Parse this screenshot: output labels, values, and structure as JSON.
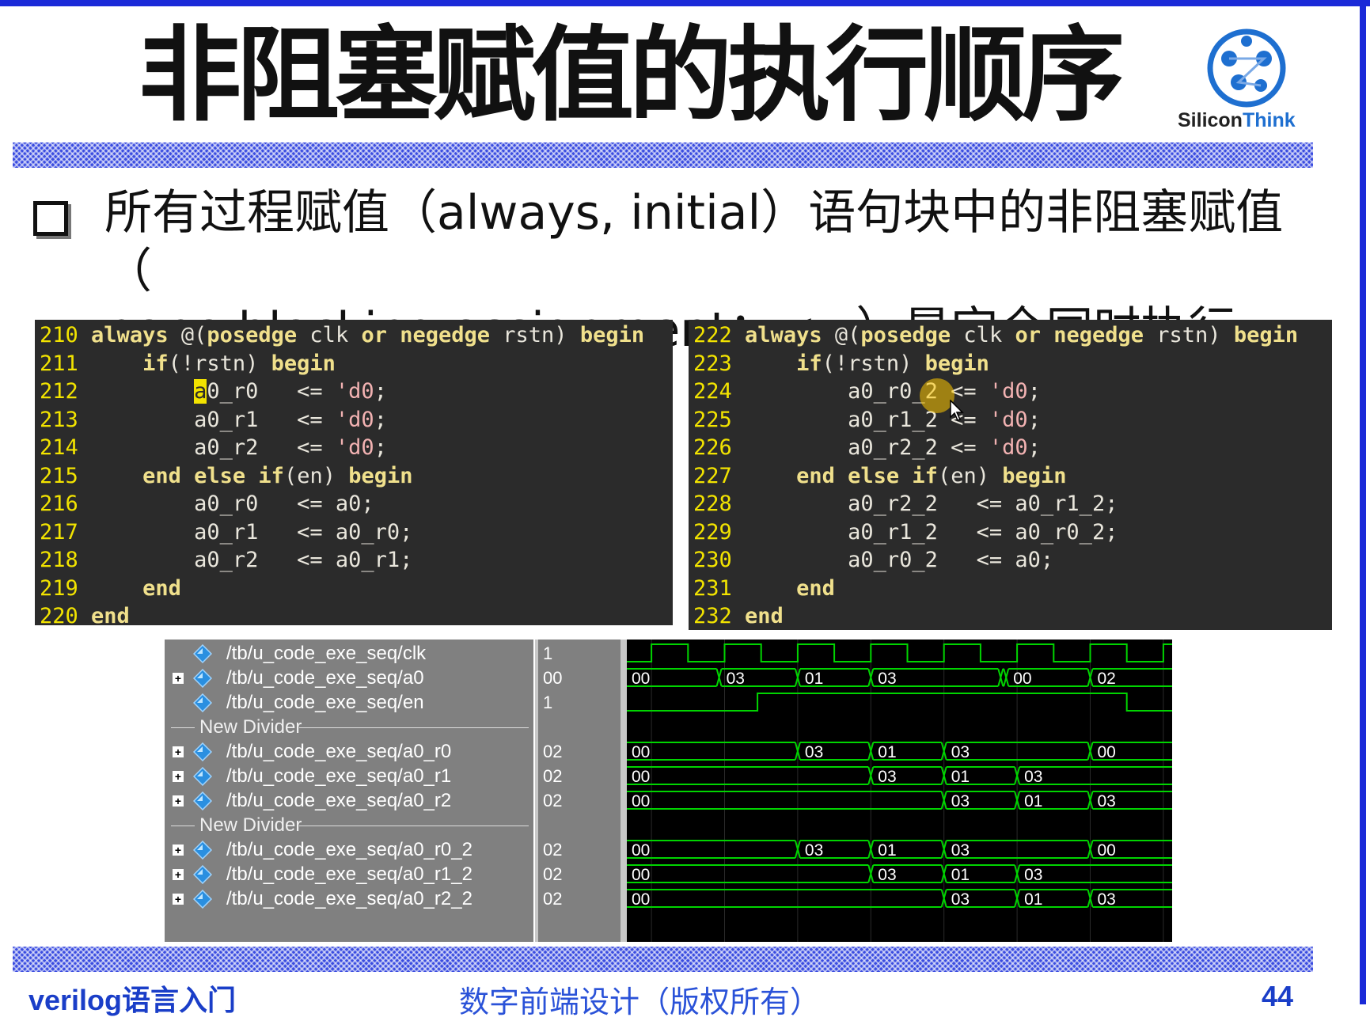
{
  "slide": {
    "title": "非阻塞赋值的执行顺序",
    "logo_text_a": "Silicon",
    "logo_text_b": "Think",
    "bullet_line1": "所有过程赋值（always, initial）语句块中的非阻塞赋值（",
    "bullet_line2": "none blocking assignment：<=）是完全同时执行的；"
  },
  "code_left": {
    "lines": [
      {
        "n": "210",
        "text": "always @(posedge clk or negedge rstn) begin"
      },
      {
        "n": "211",
        "text": "    if(!rstn) begin"
      },
      {
        "n": "212",
        "text": "        a0_r0   <= 'd0;"
      },
      {
        "n": "213",
        "text": "        a0_r1   <= 'd0;"
      },
      {
        "n": "214",
        "text": "        a0_r2   <= 'd0;"
      },
      {
        "n": "215",
        "text": "    end else if(en) begin"
      },
      {
        "n": "216",
        "text": "        a0_r0   <= a0;"
      },
      {
        "n": "217",
        "text": "        a0_r1   <= a0_r0;"
      },
      {
        "n": "218",
        "text": "        a0_r2   <= a0_r1;"
      },
      {
        "n": "219",
        "text": "    end"
      },
      {
        "n": "220",
        "text": "end"
      }
    ]
  },
  "code_right": {
    "lines": [
      {
        "n": "222",
        "text": "always @(posedge clk or negedge rstn) begin"
      },
      {
        "n": "223",
        "text": "    if(!rstn) begin"
      },
      {
        "n": "224",
        "text": "        a0_r0_2 <= 'd0;"
      },
      {
        "n": "225",
        "text": "        a0_r1_2 <= 'd0;"
      },
      {
        "n": "226",
        "text": "        a0_r2_2 <= 'd0;"
      },
      {
        "n": "227",
        "text": "    end else if(en) begin"
      },
      {
        "n": "228",
        "text": "        a0_r2_2   <= a0_r1_2;"
      },
      {
        "n": "229",
        "text": "        a0_r1_2   <= a0_r0_2;"
      },
      {
        "n": "230",
        "text": "        a0_r0_2   <= a0;"
      },
      {
        "n": "231",
        "text": "    end"
      },
      {
        "n": "232",
        "text": "end"
      }
    ]
  },
  "waveform": {
    "rows": [
      {
        "type": "signal",
        "expandable": false,
        "path": "/tb/u_code_exe_seq/clk",
        "value": "1",
        "wave": "clock"
      },
      {
        "type": "signal",
        "expandable": true,
        "path": "/tb/u_code_exe_seq/a0",
        "value": "00",
        "wave": "bus",
        "segments": [
          {
            "t": 0,
            "v": "00"
          },
          {
            "t": 2.35,
            "v": "03"
          },
          {
            "t": 4.5,
            "v": "01"
          },
          {
            "t": 6.5,
            "v": "03"
          },
          {
            "t": 10.05,
            "v": ""
          },
          {
            "t": 10.2,
            "v": "00"
          },
          {
            "t": 12.5,
            "v": "02"
          }
        ]
      },
      {
        "type": "signal",
        "expandable": false,
        "path": "/tb/u_code_exe_seq/en",
        "value": "1",
        "wave": "bit",
        "edges": [
          {
            "t": 0,
            "v": 0
          },
          {
            "t": 3.4,
            "v": 1
          },
          {
            "t": 13.5,
            "v": 0
          }
        ]
      },
      {
        "type": "divider",
        "label": "New Divider"
      },
      {
        "type": "signal",
        "expandable": true,
        "path": "/tb/u_code_exe_seq/a0_r0",
        "value": "02",
        "wave": "bus",
        "segments": [
          {
            "t": 0,
            "v": "00"
          },
          {
            "t": 4.5,
            "v": "03"
          },
          {
            "t": 6.5,
            "v": "01"
          },
          {
            "t": 8.5,
            "v": "03"
          },
          {
            "t": 12.5,
            "v": "00"
          }
        ]
      },
      {
        "type": "signal",
        "expandable": true,
        "path": "/tb/u_code_exe_seq/a0_r1",
        "value": "02",
        "wave": "bus",
        "segments": [
          {
            "t": 0,
            "v": "00"
          },
          {
            "t": 6.5,
            "v": "03"
          },
          {
            "t": 8.5,
            "v": "01"
          },
          {
            "t": 10.5,
            "v": "03"
          }
        ]
      },
      {
        "type": "signal",
        "expandable": true,
        "path": "/tb/u_code_exe_seq/a0_r2",
        "value": "02",
        "wave": "bus",
        "segments": [
          {
            "t": 0,
            "v": "00"
          },
          {
            "t": 8.5,
            "v": "03"
          },
          {
            "t": 10.5,
            "v": "01"
          },
          {
            "t": 12.5,
            "v": "03"
          }
        ]
      },
      {
        "type": "divider",
        "label": "New Divider"
      },
      {
        "type": "signal",
        "expandable": true,
        "path": "/tb/u_code_exe_seq/a0_r0_2",
        "value": "02",
        "wave": "bus",
        "segments": [
          {
            "t": 0,
            "v": "00"
          },
          {
            "t": 4.5,
            "v": "03"
          },
          {
            "t": 6.5,
            "v": "01"
          },
          {
            "t": 8.5,
            "v": "03"
          },
          {
            "t": 12.5,
            "v": "00"
          }
        ]
      },
      {
        "type": "signal",
        "expandable": true,
        "path": "/tb/u_code_exe_seq/a0_r1_2",
        "value": "02",
        "wave": "bus",
        "segments": [
          {
            "t": 0,
            "v": "00"
          },
          {
            "t": 6.5,
            "v": "03"
          },
          {
            "t": 8.5,
            "v": "01"
          },
          {
            "t": 10.5,
            "v": "03"
          }
        ]
      },
      {
        "type": "signal",
        "expandable": true,
        "path": "/tb/u_code_exe_seq/a0_r2_2",
        "value": "02",
        "wave": "bus",
        "segments": [
          {
            "t": 0,
            "v": "00"
          },
          {
            "t": 8.5,
            "v": "03"
          },
          {
            "t": 10.5,
            "v": "01"
          },
          {
            "t": 12.5,
            "v": "03"
          }
        ]
      }
    ]
  },
  "footer": {
    "left": "verilog语言入门",
    "center": "数字前端设计（版权所有）",
    "page": "44"
  },
  "colors": {
    "frame": "#1a2ad8",
    "wave_line": "#00d400",
    "code_bg": "#2b2b2b",
    "line_number": "#f2e300"
  },
  "icons": [
    "siliconthink-logo",
    "checkbox-bullet-icon",
    "signal-diamond-icon",
    "expand-plus-icon",
    "mouse-pointer-icon"
  ]
}
